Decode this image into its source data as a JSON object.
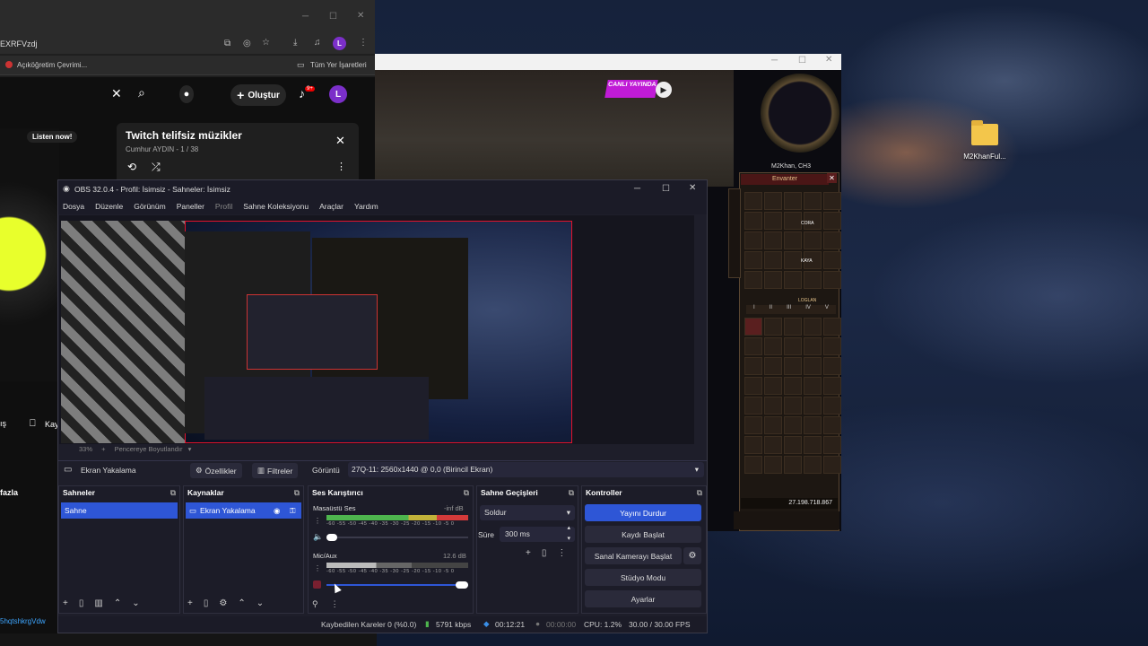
{
  "browser": {
    "address_fragment": "EXRFVzdj",
    "bookmark_left": "Açıköğretim Çevrimi...",
    "bookmark_right": "Tüm Yer İşaretleri",
    "create_label": "Oluştur",
    "notif_count": "9+",
    "avatar_letter": "L",
    "listen_now": "Listen now!",
    "playlist_title": "Twitch telifsiz müzikler",
    "playlist_sub": "Cumhur AYDIN - 1 / 38",
    "side_text_1": "ış",
    "side_text_2": "Kay",
    "side_text_3": "fazla",
    "bottom_link": "5hqtshkrgVdw"
  },
  "game": {
    "live_badge": "CANLI YAYINDA",
    "char_name": "M2Khan, CH3",
    "inventory_title": "Envanter",
    "gold": "27.198.718.867",
    "roman_tabs": [
      "I",
      "II",
      "III",
      "IV",
      "V"
    ],
    "slot_label_1": "CORA",
    "slot_label_2": "KAYA",
    "slot_label_3": "LOGLAN"
  },
  "desktop": {
    "folder_label": "M2KhanFul..."
  },
  "obs": {
    "title": "OBS 32.0.4 - Profil: İsimsiz - Sahneler: İsimsiz",
    "menu": [
      "Dosya",
      "Düzenle",
      "Görünüm",
      "Paneller",
      "Profil",
      "Sahne Koleksiyonu",
      "Araçlar",
      "Yardım"
    ],
    "zoom": "33%",
    "zoom_mode": "Pencereye Boyutlandır",
    "source_name": "Ekran Yakalama",
    "properties": "Özellikler",
    "filters": "Filtreler",
    "display_label": "Görüntü",
    "display_value": "27Q-11: 2560x1440 @ 0,0 (Birincil Ekran)",
    "docks": {
      "scenes": "Sahneler",
      "sources": "Kaynaklar",
      "mixer": "Ses Karıştırıcı",
      "transitions": "Sahne Geçişleri",
      "controls": "Kontroller"
    },
    "scene_item": "Sahne",
    "source_item": "Ekran Yakalama",
    "mixer": {
      "desktop_label": "Masaüstü Ses",
      "desktop_db": "-inf dB",
      "mic_label": "Mic/Aux",
      "mic_db": "12.6 dB",
      "ticks": "-60 -55 -50 -45 -40 -35 -30 -25 -20 -15 -10 -5 0"
    },
    "transition": {
      "type": "Soldur",
      "duration_label": "Süre",
      "duration_value": "300 ms"
    },
    "controls": {
      "stop_stream": "Yayını Durdur",
      "start_record": "Kaydı Başlat",
      "virtual_cam": "Sanal Kamerayı Başlat",
      "studio_mode": "Stüdyo Modu",
      "settings": "Ayarlar"
    },
    "status": {
      "dropped": "Kaybedilen Kareler 0 (%0.0)",
      "bitrate": "5791 kbps",
      "live_time": "00:12:21",
      "rec_time": "00:00:00",
      "cpu": "CPU: 1.2%",
      "fps": "30.00 / 30.00 FPS"
    },
    "accent": "#2e56d6"
  }
}
